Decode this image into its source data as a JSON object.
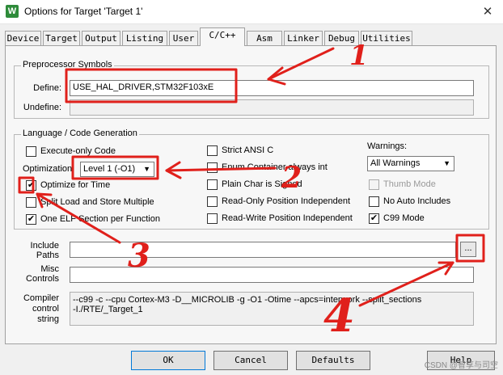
{
  "window": {
    "title": "Options for Target 'Target 1'",
    "icon": "keil-app-icon"
  },
  "tabs": [
    "Device",
    "Target",
    "Output",
    "Listing",
    "User",
    "C/C++",
    "Asm",
    "Linker",
    "Debug",
    "Utilities"
  ],
  "active_tab": "C/C++",
  "preprocessor": {
    "group_label": "Preprocessor Symbols",
    "define_label": "Define:",
    "define_value": "USE_HAL_DRIVER,STM32F103xE",
    "undefine_label": "Undefine:",
    "undefine_value": ""
  },
  "codegen": {
    "group_label": "Language / Code Generation",
    "execute_only": {
      "label": "Execute-only Code",
      "checked": false
    },
    "optimization_label": "Optimization:",
    "optimization_value": "Level 1 (-O1)",
    "optimize_time": {
      "label": "Optimize for Time",
      "checked": true
    },
    "split_load": {
      "label": "Split Load and Store Multiple",
      "checked": false
    },
    "one_elf": {
      "label": "One ELF Section per Function",
      "checked": true
    },
    "strict_ansi": {
      "label": "Strict ANSI C",
      "checked": false
    },
    "enum_int": {
      "label": "Enum Container always int",
      "checked": false
    },
    "plain_char": {
      "label": "Plain Char is Signed",
      "checked": false
    },
    "ropi": {
      "label": "Read-Only Position Independent",
      "checked": false
    },
    "rwpi": {
      "label": "Read-Write Position Independent",
      "checked": false
    },
    "warnings_label": "Warnings:",
    "warnings_value": "All Warnings",
    "thumb_mode": {
      "label": "Thumb Mode",
      "checked": false
    },
    "no_auto_includes": {
      "label": "No Auto Includes",
      "checked": false
    },
    "c99_mode": {
      "label": "C99 Mode",
      "checked": true
    }
  },
  "paths": {
    "include_label": "Include\nPaths",
    "include_value": "",
    "browse_label": "...",
    "misc_label": "Misc\nControls",
    "misc_value": ""
  },
  "compiler": {
    "label": "Compiler\ncontrol\nstring",
    "value": "--c99 -c --cpu Cortex-M3 -D__MICROLIB -g -O1 -Otime --apcs=interwork --split_sections\n-I./RTE/_Target_1"
  },
  "buttons": {
    "ok": "OK",
    "cancel": "Cancel",
    "defaults": "Defaults",
    "help": "Help"
  },
  "watermark": "CSDN @智享与司空",
  "annotations": {
    "numbers": [
      "1",
      "2",
      "3",
      "4"
    ],
    "color": "#e0201b"
  },
  "colors": {
    "panel_bg": "#f7f7f7",
    "window_bg": "#f0f0f0",
    "accent": "#0078d7"
  }
}
